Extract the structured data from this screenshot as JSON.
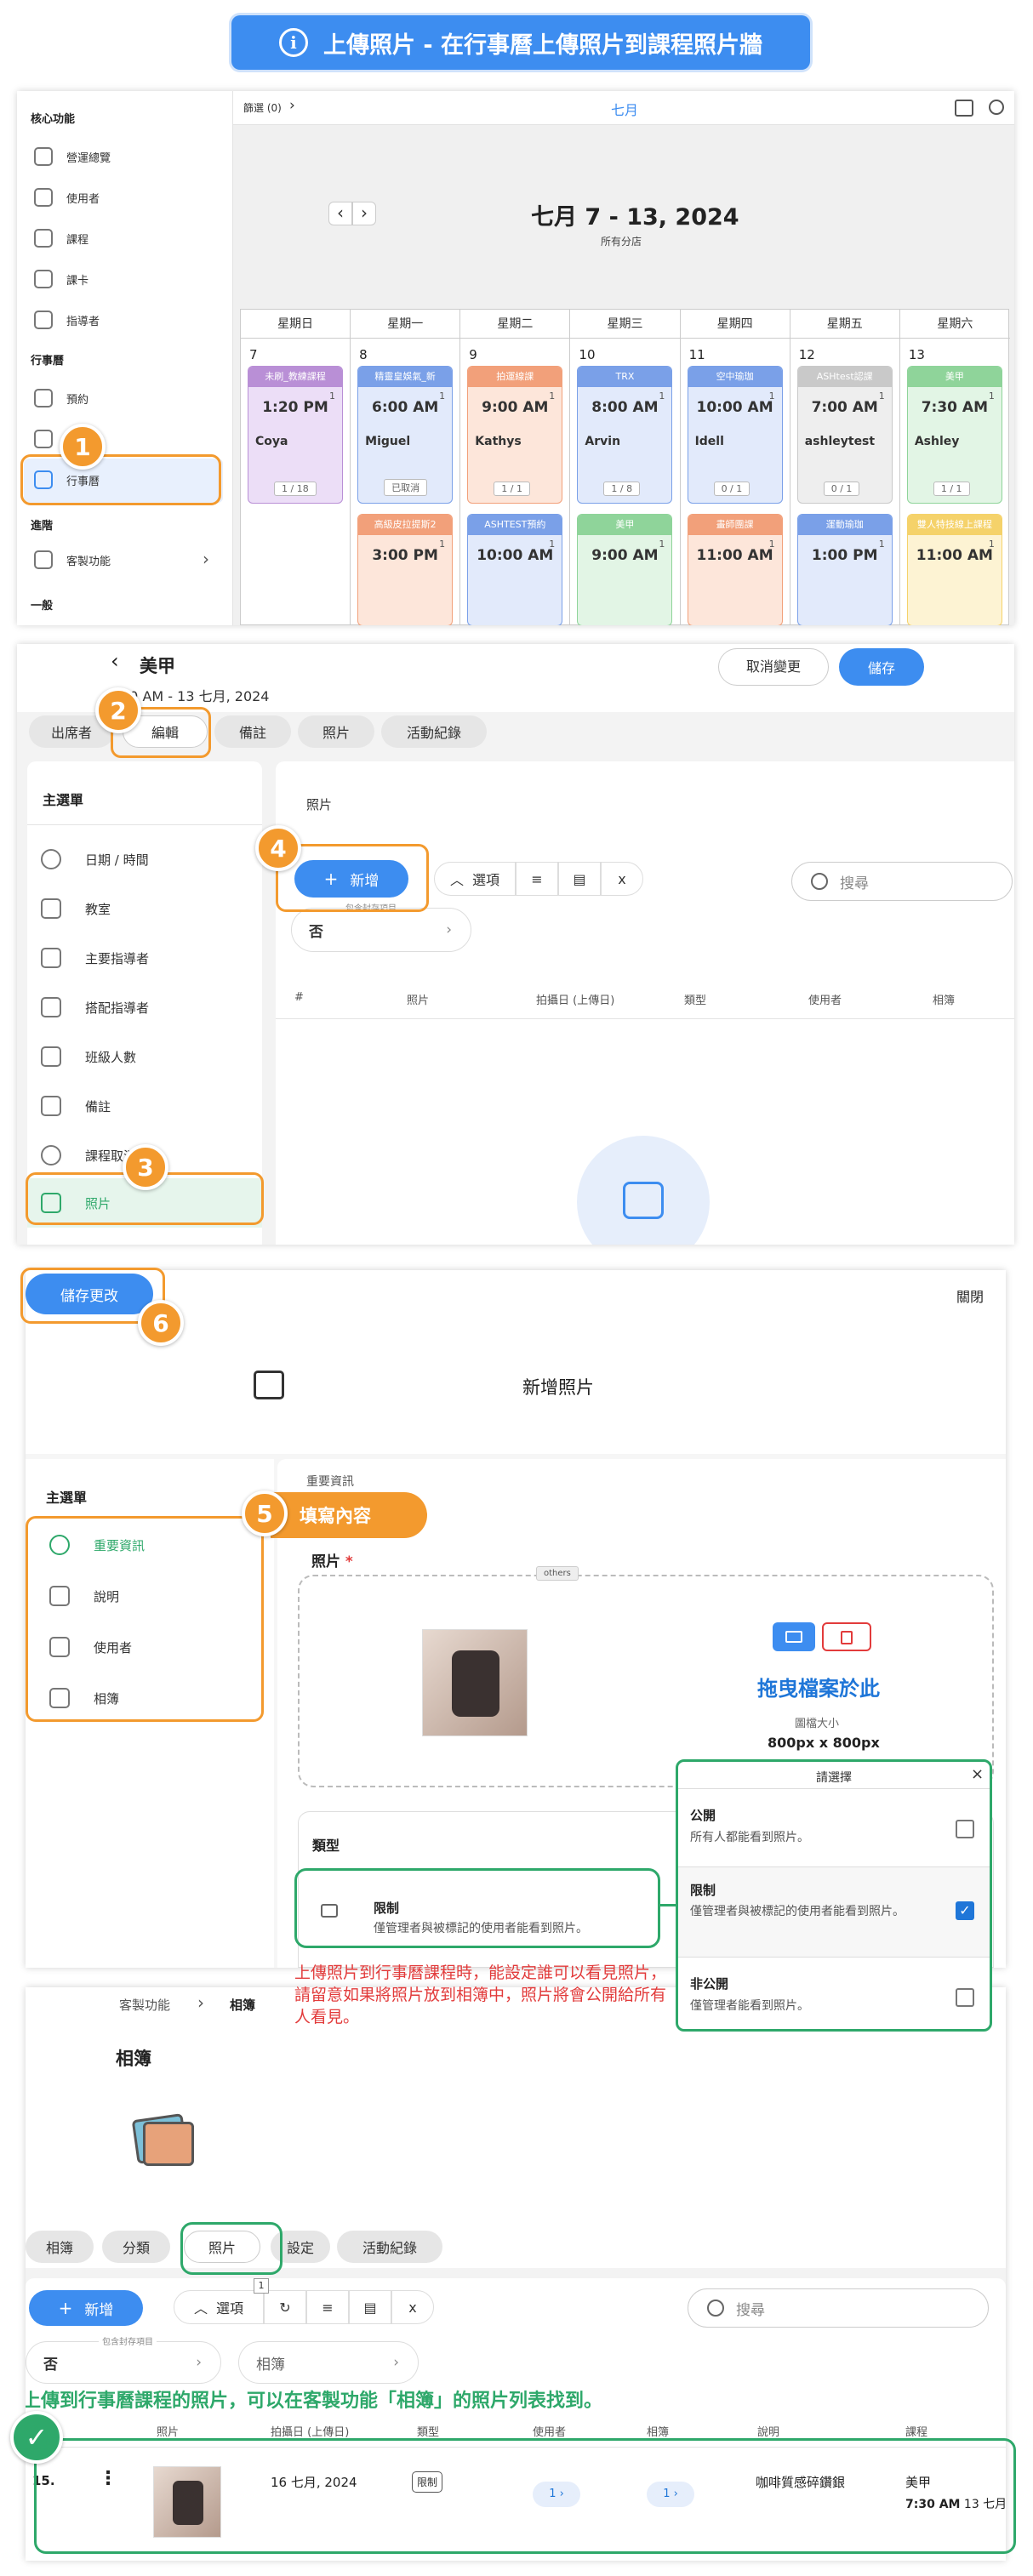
{
  "banner": {
    "icon": "info-icon",
    "glyph": "i",
    "text": "上傳照片 - 在行事曆上傳照片到課程照片牆"
  },
  "cal": {
    "sidebar": {
      "h1": "核心功能",
      "items1": [
        "營運總覽",
        "使用者",
        "課程",
        "課卡",
        "指導者"
      ],
      "h2": "行事曆",
      "items2": [
        "預約",
        "",
        "行事曆"
      ],
      "h3": "進階",
      "items3": [
        "客製功能"
      ],
      "h4": "一般"
    },
    "topbar": {
      "breadcrumb": "篩選 (0)",
      "chev": "›",
      "month": "七月"
    },
    "nav": {
      "prev": "‹",
      "next": "›"
    },
    "range": "七月 7 - 13, 2024",
    "scope": "所有分店",
    "days": [
      "星期日",
      "星期一",
      "星期二",
      "星期三",
      "星期四",
      "星期五",
      "星期六"
    ],
    "dates": [
      "7",
      "8",
      "9",
      "10",
      "11",
      "12",
      "13"
    ],
    "events1": [
      {
        "head": "未刷_教練課程",
        "color": "#b98fd6",
        "bg": "#ecdef7",
        "time": "1:20 PM",
        "who": "Coya",
        "count": "1",
        "cap": "1 / 18"
      },
      {
        "head": "精靈皇娛氣_新",
        "color": "#7aa0e8",
        "bg": "#e2eafb",
        "time": "6:00 AM",
        "who": "Miguel",
        "count": "1",
        "cap": "已取消"
      },
      {
        "head": "拍運線課",
        "color": "#f2a07a",
        "bg": "#fde6da",
        "time": "9:00 AM",
        "who": "Kathys",
        "count": "1",
        "cap": "1 / 1"
      },
      {
        "head": "TRX",
        "color": "#7aa0e8",
        "bg": "#e2eafb",
        "time": "8:00 AM",
        "who": "Arvin",
        "count": "1",
        "cap": "1 / 8"
      },
      {
        "head": "空中瑜珈",
        "color": "#7aa0e8",
        "bg": "#e2eafb",
        "time": "10:00 AM",
        "who": "Idell",
        "count": "1",
        "cap": "0 / 1"
      },
      {
        "head": "ASHtest認課",
        "color": "#c9c9c9",
        "bg": "#eeeeee",
        "time": "7:00 AM",
        "who": "ashleytest",
        "count": "1",
        "cap": "0 / 1"
      },
      {
        "head": "美甲",
        "color": "#8fd49a",
        "bg": "#e2f5e5",
        "time": "7:30 AM",
        "who": "Ashley",
        "count": "1",
        "cap": "1 / 1"
      }
    ],
    "events2": [
      {
        "day": 1,
        "head": "高級皮拉提斯2",
        "color": "#f2a07a",
        "bg": "#fde6da",
        "time": "3:00 PM",
        "count": "1"
      },
      {
        "day": 2,
        "head": "ASHTEST預約",
        "color": "#7aa0e8",
        "bg": "#e2eafb",
        "time": "10:00 AM",
        "count": "1"
      },
      {
        "day": 3,
        "head": "美甲",
        "color": "#8fd49a",
        "bg": "#e2f5e5",
        "time": "9:00 AM",
        "count": "1"
      },
      {
        "day": 4,
        "head": "畫師團課",
        "color": "#f2a07a",
        "bg": "#fde6da",
        "time": "11:00 AM",
        "count": "1"
      },
      {
        "day": 5,
        "head": "運動瑜珈",
        "color": "#7aa0e8",
        "bg": "#e2eafb",
        "time": "1:00 PM",
        "count": "1"
      },
      {
        "day": 6,
        "head": "雙人特技線上課程",
        "color": "#f5d26a",
        "bg": "#fdf3d3",
        "time": "11:00 AM",
        "count": "1"
      }
    ]
  },
  "edit": {
    "back": "‹",
    "title": "美甲",
    "subtitle": "20 AM - 13 七月, 2024",
    "cancel": "取消變更",
    "save": "儲存",
    "tabs": [
      "出席者",
      "編輯",
      "備註",
      "照片",
      "活動紀錄"
    ],
    "menu_h": "主選單",
    "menu": [
      "日期 / 時間",
      "教室",
      "主要指導者",
      "搭配指導者",
      "班級人數",
      "備註",
      "課程取消",
      "照片"
    ],
    "section": "照片",
    "add": "新增",
    "plus": "+",
    "options": "選項",
    "include_label": "包含封存項目",
    "include_value": "否",
    "search": "搜尋",
    "cols": [
      "#",
      "照片",
      "拍攝日 (上傳日)",
      "類型",
      "使用者",
      "相簿"
    ]
  },
  "modal": {
    "save": "儲存更改",
    "close": "關閉",
    "title": "新增照片",
    "menu_h": "主選單",
    "menu": [
      "重要資訊",
      "說明",
      "使用者",
      "相簿"
    ],
    "section": "重要資訊",
    "callout": "填寫內容",
    "photo_label": "照片",
    "req": "*",
    "tag": "others",
    "drop": "拖曳檔案於此",
    "size_label": "圖檔大小",
    "size": "800px x 800px",
    "type_label": "類型",
    "type_value": "限制",
    "type_desc": "僅管理者與被標記的使用者能看到照片。",
    "picker_title": "請選擇",
    "picker_close": "×",
    "options": [
      {
        "t": "公開",
        "d": "所有人都能看到照片。",
        "checked": false
      },
      {
        "t": "限制",
        "d": "僅管理者與被標記的使用者能看到照片。",
        "checked": true
      },
      {
        "t": "非公開",
        "d": "僅管理者能看到照片。",
        "checked": false
      }
    ],
    "note": "上傳照片到行事曆課程時，能設定誰可以看見照片，請留意如果將照片放到相簿中，照片將會公開給所有人看見。"
  },
  "album": {
    "crumb1": "客製功能",
    "crumb_sep": "›",
    "crumb2": "相簿",
    "title": "相簿",
    "tabs": [
      "相簿",
      "分類",
      "照片",
      "設定",
      "活動紀錄"
    ],
    "add": "新增",
    "plus": "+",
    "options": "選項",
    "badge": "1",
    "include_label": "包含封存項目",
    "include_value": "否",
    "filter2": "相簿",
    "search": "搜尋",
    "caption": "上傳到行事曆課程的照片，可以在客製功能「相簿」的照片列表找到。",
    "cols": [
      "照片",
      "拍攝日 (上傳日)",
      "類型",
      "使用者",
      "相簿",
      "說明",
      "課程"
    ],
    "row": {
      "num": "15.",
      "date": "16 七月, 2024",
      "type": "限制",
      "user": "1",
      "album": "1",
      "desc": "咖啡質感碎鑽銀",
      "course": "美甲",
      "course_time": "7:30 AM",
      "course_date": "13 七月"
    }
  },
  "steps": [
    "1",
    "2",
    "3",
    "4",
    "5",
    "6"
  ]
}
